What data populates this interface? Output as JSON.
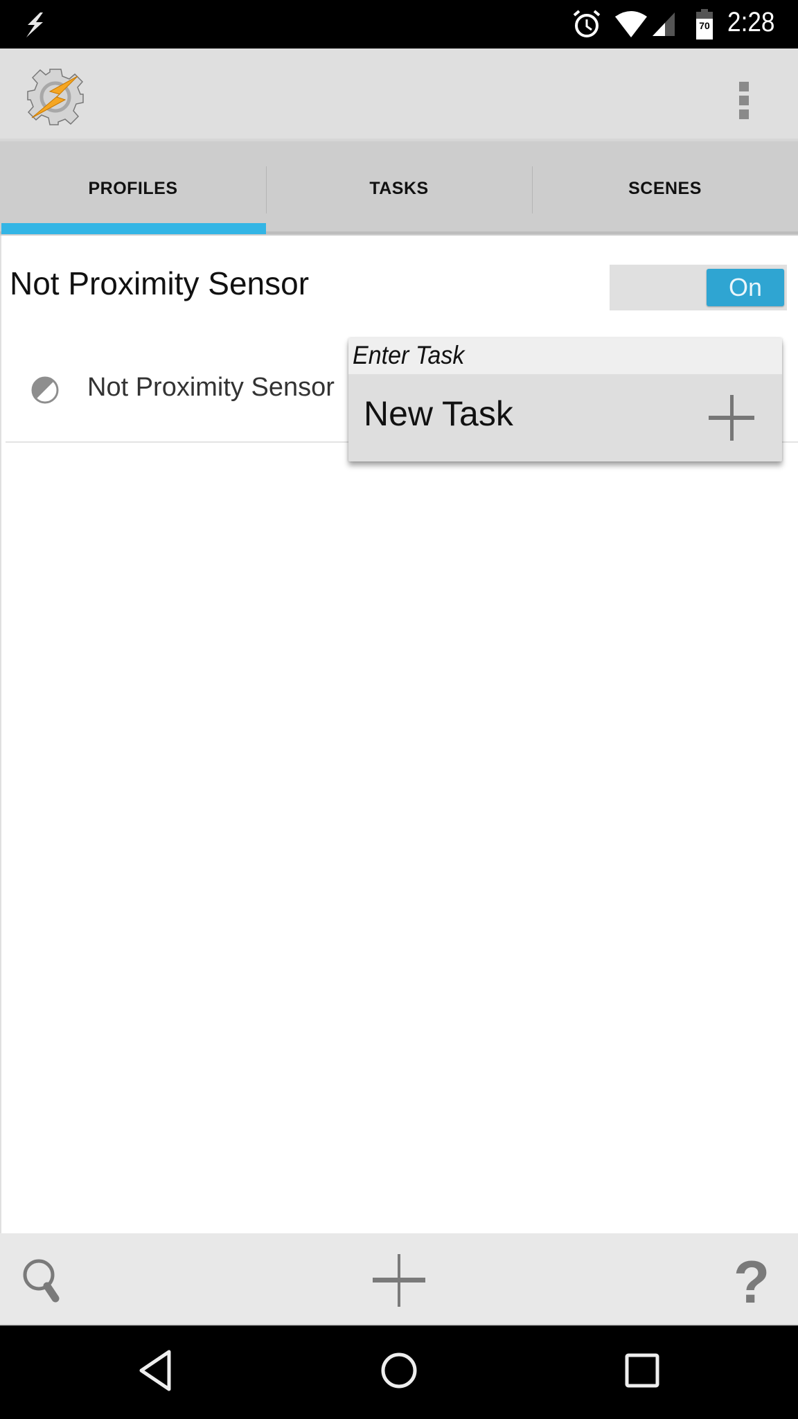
{
  "status_bar": {
    "time": "2:28",
    "battery_level": "70",
    "icons": [
      "flash-notification-icon",
      "alarm-icon",
      "wifi-icon",
      "cell-signal-icon",
      "battery-icon"
    ]
  },
  "app_bar": {
    "logo": "tasker-gear-bolt-logo",
    "overflow_icon": "overflow-menu-icon"
  },
  "tabs": [
    {
      "label": "PROFILES",
      "selected": true
    },
    {
      "label": "TASKS",
      "selected": false
    },
    {
      "label": "SCENES",
      "selected": false
    }
  ],
  "colors": {
    "accent": "#33b5e5",
    "toggle_on": "#2fa5d2",
    "app_bar_bg": "#dfdfdf",
    "tab_bg": "#cdcdcd"
  },
  "profile": {
    "name": "Not Proximity Sensor",
    "toggle_label": "On",
    "toggle_state": "on",
    "context": {
      "icon": "proximity-sensor-icon",
      "label": "Not Proximity Sensor"
    }
  },
  "popup": {
    "title": "Enter Task",
    "items": [
      {
        "label": "New Task",
        "icon": "plus-icon"
      }
    ]
  },
  "bottom_bar": {
    "buttons": [
      {
        "name": "search",
        "icon": "search-icon"
      },
      {
        "name": "add",
        "icon": "plus-icon"
      },
      {
        "name": "help",
        "icon": "help-icon"
      }
    ]
  },
  "nav_bar": {
    "buttons": [
      "back",
      "home",
      "recents"
    ]
  }
}
